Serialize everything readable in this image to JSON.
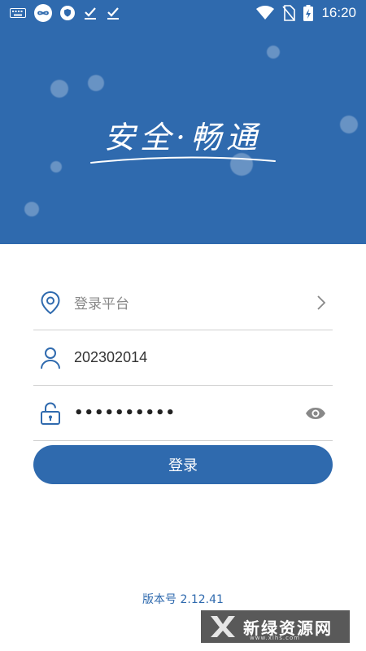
{
  "status_bar": {
    "time": "16:20",
    "icons_left": [
      "keyboard-icon",
      "infinity-app-icon",
      "shield-app-icon",
      "download-done-icon",
      "download-done-icon"
    ],
    "icons_right": [
      "wifi-icon",
      "no-sim-icon",
      "battery-charging-icon"
    ]
  },
  "hero": {
    "slogan": "安全·畅通",
    "background_color": "#2f6aae"
  },
  "form": {
    "platform": {
      "placeholder": "登录平台",
      "icon": "location-pin-icon",
      "trailing_icon": "chevron-right-icon"
    },
    "username": {
      "value": "202302014",
      "icon": "user-icon"
    },
    "password": {
      "value": "••••••••••",
      "icon": "lock-icon",
      "trailing_icon": "eye-icon"
    }
  },
  "login_button": {
    "label": "登录"
  },
  "version": {
    "text": "版本号 2.12.41"
  },
  "watermark": {
    "text": "新绿资源网",
    "sub": "www.xlhs.com"
  },
  "colors": {
    "accent": "#2f6aae",
    "divider": "#d0d0d0",
    "icon": "#2f6aae"
  }
}
